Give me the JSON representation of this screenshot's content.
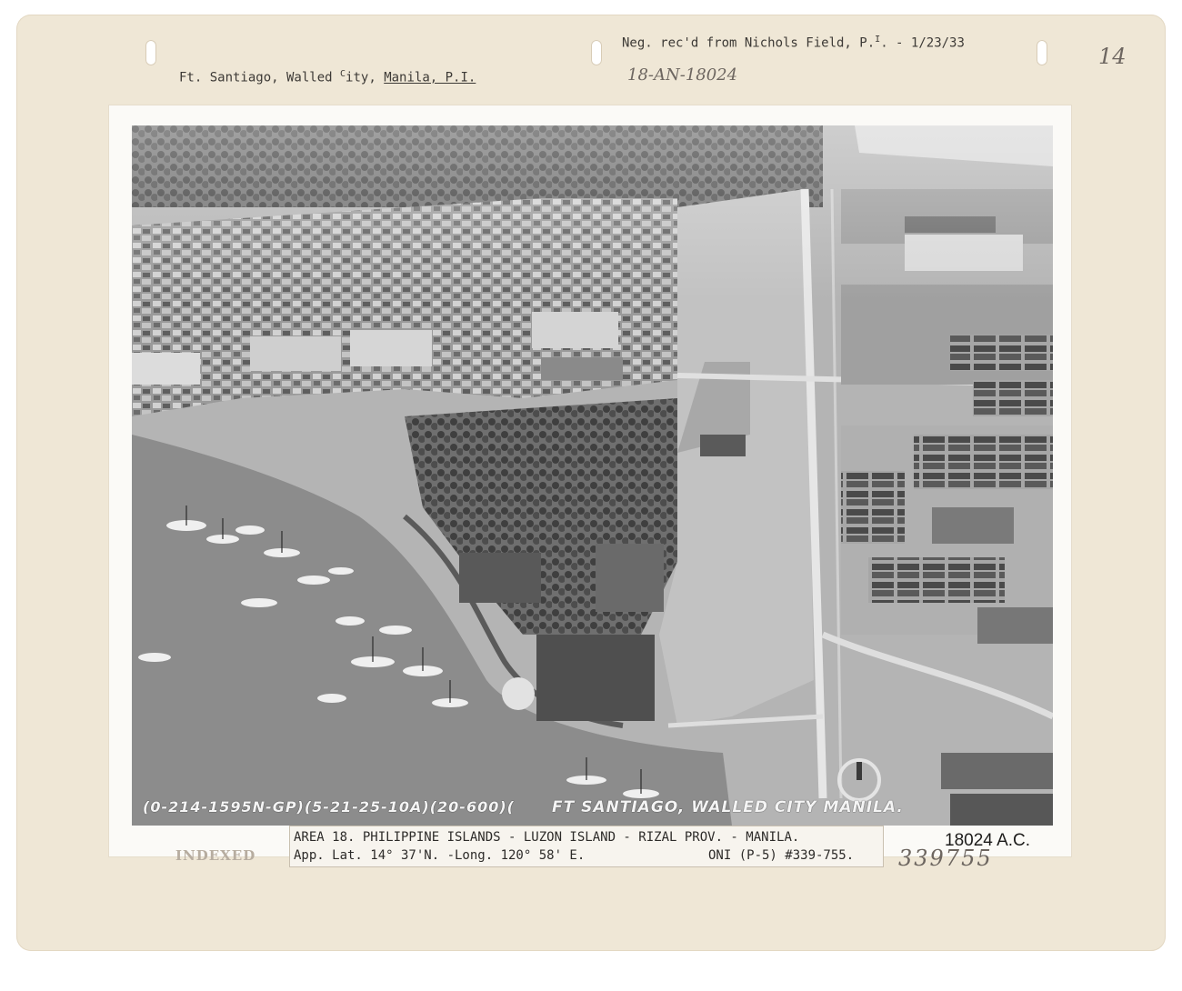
{
  "header": {
    "title": "Ft. Santiago, Walled City, Manila, P.I.",
    "title_prefix": "Ft. Santiago, Walled ",
    "title_c": "C",
    "title_mid": "ity, ",
    "title_manila": "Manila, P.I.",
    "neg_note": "Neg. rec'd from Nichols Field, P.",
    "neg_note_sup": "I",
    "neg_note_date": ". - 1/23/33",
    "handwritten_code": "18-AN-18024",
    "corner_number": "14"
  },
  "photo_overlay": {
    "negative_code": "(0-214-1595N-GP)(5-21-25-10A)(20-600)(",
    "location": "FT SANTIAGO, WALLED CITY MANILA."
  },
  "caption": {
    "line1": "AREA 18.  PHILIPPINE ISLANDS - LUZON ISLAND - RIZAL PROV. - MANILA.",
    "line2_left": "App. Lat. 14° 37'N. -Long. 120° 58' E.",
    "line2_right": "ONI (P-5) #339-755.",
    "ac_number": "18024 A.C.",
    "handwritten_number": "339755"
  },
  "stamp": {
    "indexed": "INDEXED"
  },
  "colors": {
    "mount": "#efe7d6",
    "photo_water": "#8e8e8e",
    "photo_land": "#b6b6b6"
  }
}
